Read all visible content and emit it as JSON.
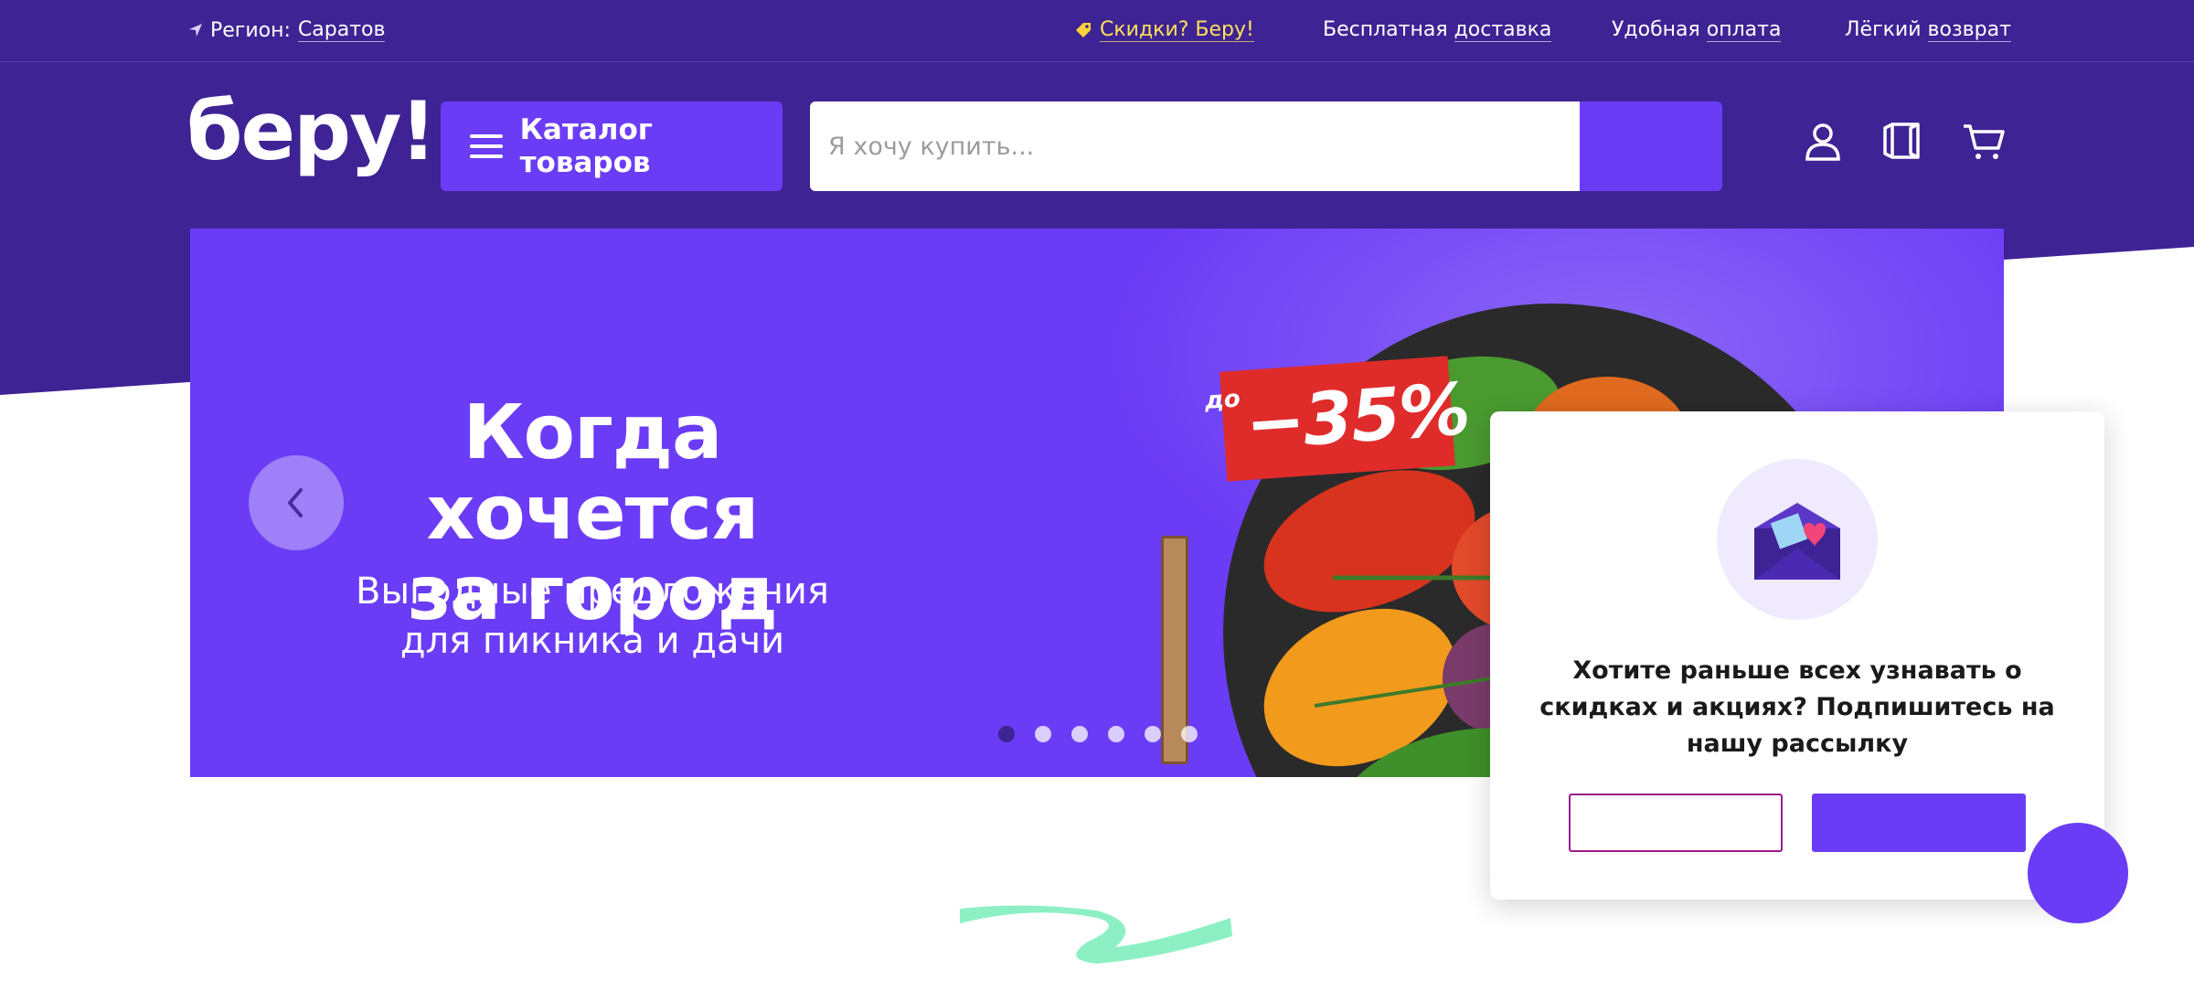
{
  "topbar": {
    "region_label": "Регион:",
    "region_city": "Саратов",
    "promo_label": "Скидки? Беру!",
    "delivery_a": "Бесплатная",
    "delivery_b": "доставка",
    "payment_a": "Удобная",
    "payment_b": "оплата",
    "return_a": "Лёгкий",
    "return_b": "возврат"
  },
  "header": {
    "logo": "беру!",
    "catalog_label": "Каталог товаров",
    "search_placeholder": "Я хочу купить..."
  },
  "banner": {
    "title_line1": "Когда хочется",
    "title_line2": "за город",
    "subtitle_line1": "Выгодные предложения",
    "subtitle_line2": "для пикника и дачи",
    "sale_prefix": "до",
    "sale_value": "−35%",
    "dots_count": 6,
    "active_dot": 0
  },
  "popup": {
    "text": "Хотите раньше всех узнавать о скидках и акциях? Подпишитесь на нашу рассылку"
  },
  "colors": {
    "header_bg": "#3e2394",
    "accent": "#6b3cf5",
    "promo": "#ffe15a",
    "sale": "#e02b2b",
    "mint": "#8df0c4"
  }
}
